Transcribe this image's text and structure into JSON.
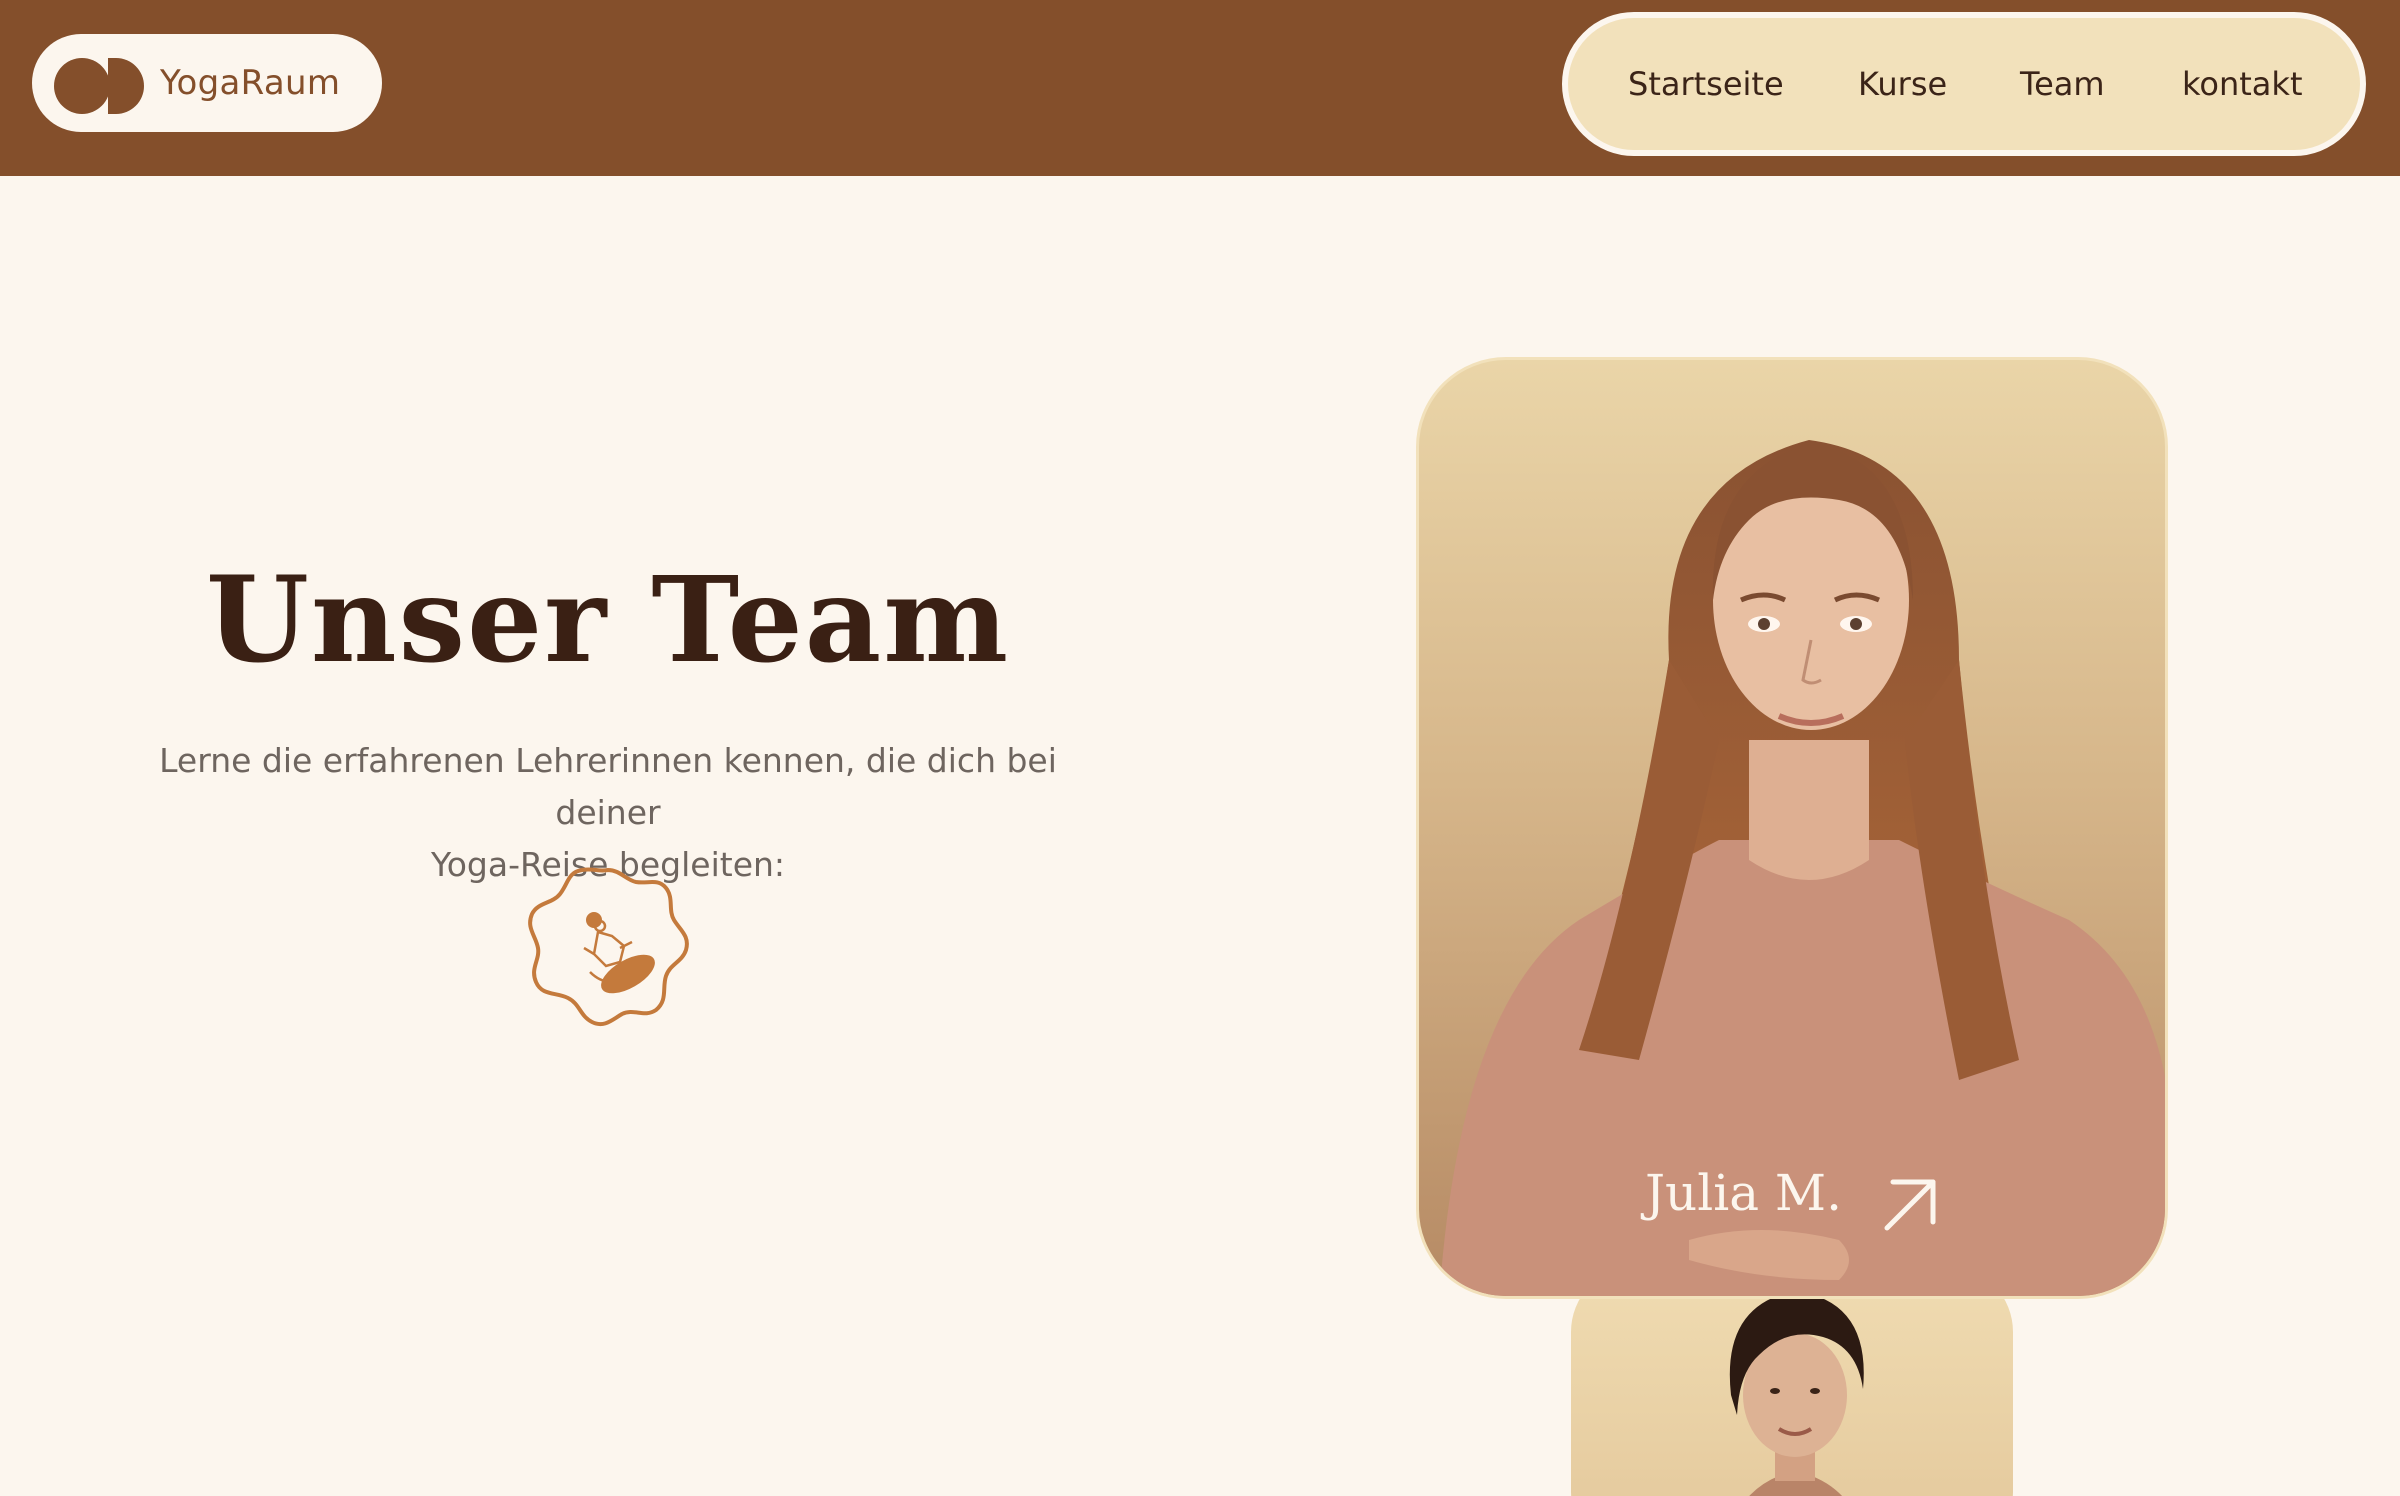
{
  "brand": {
    "name": "YogaRaum"
  },
  "nav": {
    "items": [
      {
        "label": "Startseite"
      },
      {
        "label": "Kurse"
      },
      {
        "label": "Team"
      },
      {
        "label": "kontakt"
      }
    ]
  },
  "hero": {
    "title": "Unser Team",
    "subtitle_line1": "Lerne die erfahrenen Lehrerinnen kennen, die dich bei deiner",
    "subtitle_line2": "Yoga-Reise begleiten:",
    "badge_icon": "meditation-badge-icon"
  },
  "team": {
    "cards": [
      {
        "name": "Julia M.",
        "icon": "arrow-up-right-icon"
      },
      {
        "name": ""
      }
    ]
  },
  "colors": {
    "header_bg": "#844f2b",
    "page_bg": "#fcf6ee",
    "nav_bg": "#f2e1bb",
    "accent": "#c47a3c",
    "heading": "#3a2014"
  }
}
